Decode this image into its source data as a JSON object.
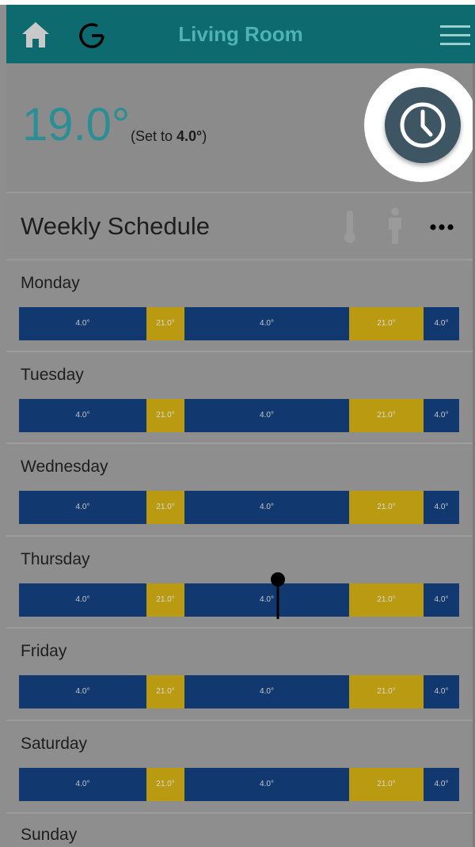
{
  "header": {
    "title": "Living Room",
    "icons": {
      "home": "home-icon",
      "sync": "sync-icon",
      "menu": "hamburger-menu-icon"
    },
    "background": "#0d6a6e",
    "title_color": "#4fb3b5"
  },
  "temperature": {
    "current": "19.0°",
    "set_prefix": "(Set to ",
    "set_value": "4.0°",
    "set_suffix": ")",
    "color": "#2a8e95"
  },
  "clock_button": {
    "icon": "clock-icon"
  },
  "schedule": {
    "title": "Weekly Schedule",
    "icons": [
      "thermometer-icon",
      "person-icon",
      "more-icon"
    ],
    "cold_color": "#123870",
    "warm_color": "#b99a10",
    "current_time_marker_day": "Thursday",
    "days": [
      {
        "name": "Monday",
        "segments": [
          "4.0°",
          "21.0°",
          "4.0°",
          "21.0°",
          "4.0°"
        ]
      },
      {
        "name": "Tuesday",
        "segments": [
          "4.0°",
          "21.0°",
          "4.0°",
          "21.0°",
          "4.0°"
        ]
      },
      {
        "name": "Wednesday",
        "segments": [
          "4.0°",
          "21.0°",
          "4.0°",
          "21.0°",
          "4.0°"
        ]
      },
      {
        "name": "Thursday",
        "segments": [
          "4.0°",
          "21.0°",
          "4.0°",
          "21.0°",
          "4.0°"
        ]
      },
      {
        "name": "Friday",
        "segments": [
          "4.0°",
          "21.0°",
          "4.0°",
          "21.0°",
          "4.0°"
        ]
      },
      {
        "name": "Saturday",
        "segments": [
          "4.0°",
          "21.0°",
          "4.0°",
          "21.0°",
          "4.0°"
        ]
      },
      {
        "name": "Sunday",
        "segments": []
      }
    ]
  }
}
